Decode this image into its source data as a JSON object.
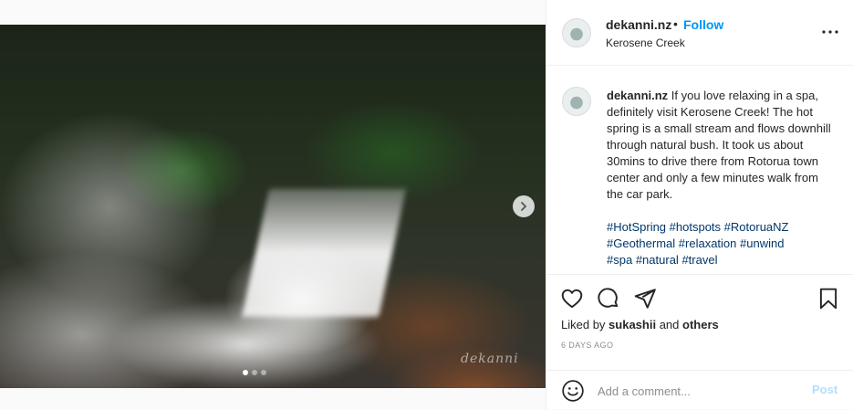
{
  "post": {
    "username": "dekanni.nz",
    "separator": "•",
    "follow_label": "Follow",
    "location": "Kerosene Creek",
    "more_icon": "more-horizontal-icon",
    "caption_text": " If you love relaxing in a spa, definitely visit Kerosene Creek! The hot spring is a small stream and flows downhill through natural bush. It took us about 30mins to drive there from Rotorua town center and only a few minutes walk from the car park.",
    "hashtags": [
      "#HotSpring",
      "#hotspots",
      "#RotoruaNZ",
      "#Geothermal",
      "#relaxation",
      "#unwind",
      "#spa",
      "#natural",
      "#travel"
    ],
    "likes_prefix": "Liked by ",
    "liked_by_user": "sukashii",
    "likes_and": " and ",
    "likes_others": "others",
    "timestamp": "6 DAYS AGO"
  },
  "media": {
    "watermark": "dekanni",
    "slide_count": 3,
    "active_slide": 1
  },
  "comment_box": {
    "placeholder": "Add a comment...",
    "post_label": "Post"
  },
  "colors": {
    "accent": "#0095f6",
    "hashtag": "#00376b",
    "post_disabled": "#b2dffc",
    "muted": "#8e8e8e"
  },
  "icons": [
    "heart-icon",
    "comment-icon",
    "share-icon",
    "bookmark-icon",
    "emoji-icon",
    "chevron-right-icon"
  ]
}
